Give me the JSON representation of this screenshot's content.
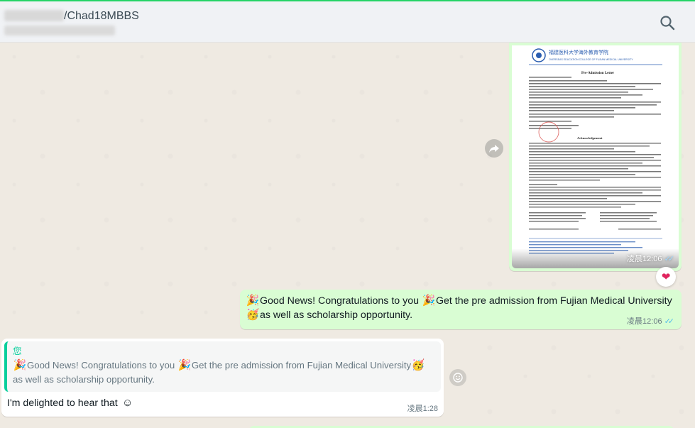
{
  "header": {
    "title": "/Chad18MBBS",
    "search_icon": "search-icon"
  },
  "messages": {
    "document_image": {
      "institution_cn": "福建医科大学海外教育学院",
      "institution_en": "OVERSEAS EDUCATION COLLEGE OF FUJIAN MEDICAL UNIVERSITY",
      "letter_title": "Pre-Admission Letter",
      "section_title": "Acknowledgement",
      "time": "凌晨12:06"
    },
    "outgoing": {
      "text_line1": "Good News! Congratulations to you",
      "text_line1b": "Get the pre admission from Fujian Medical University",
      "text_line2": "as well as scholarship opportunity.",
      "time": "凌晨12:06"
    },
    "incoming": {
      "quote_author": "您",
      "quote_line1a": "Good News! Congratulations to you",
      "quote_line1b": "Get the pre admission from Fujian Medical University",
      "quote_line2": "as well as scholarship opportunity.",
      "reply_text": "I'm delighted to hear that",
      "time": "凌晨1:28"
    }
  },
  "icons": {
    "forward": "forward-icon",
    "reaction": "heart-reaction-icon",
    "emoji": "emoji-icon",
    "party": "party-popper-icon",
    "smile": "smiling-face-icon",
    "ticks": "double-check-icon"
  },
  "colors": {
    "outgoing_bubble": "#d9fdd3",
    "incoming_bubble": "#ffffff",
    "accent": "#06cf9c",
    "read_ticks": "#53bdeb",
    "reaction_heart": "#e0245e"
  }
}
